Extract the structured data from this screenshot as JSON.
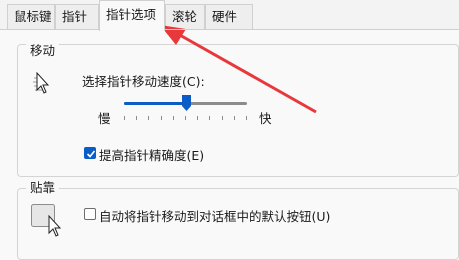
{
  "tabs": [
    {
      "label": "鼠标键"
    },
    {
      "label": "指针"
    },
    {
      "label": "指针选项"
    },
    {
      "label": "滚轮"
    },
    {
      "label": "硬件"
    }
  ],
  "active_tab": "指针选项",
  "motion": {
    "title": "移动",
    "speed_label": "选择指针移动速度(C):",
    "slow_label": "慢",
    "fast_label": "快",
    "speed_fraction": 0.5,
    "precision_label": "提高指针精确度(E)",
    "precision_checked": true
  },
  "snap": {
    "title": "贴靠",
    "snap_label": "自动将指针移动到对话框中的默认按钮(U)",
    "snap_checked": false
  },
  "colors": {
    "accent": "#0b5cc7",
    "annotation_arrow": "#e8383b"
  }
}
